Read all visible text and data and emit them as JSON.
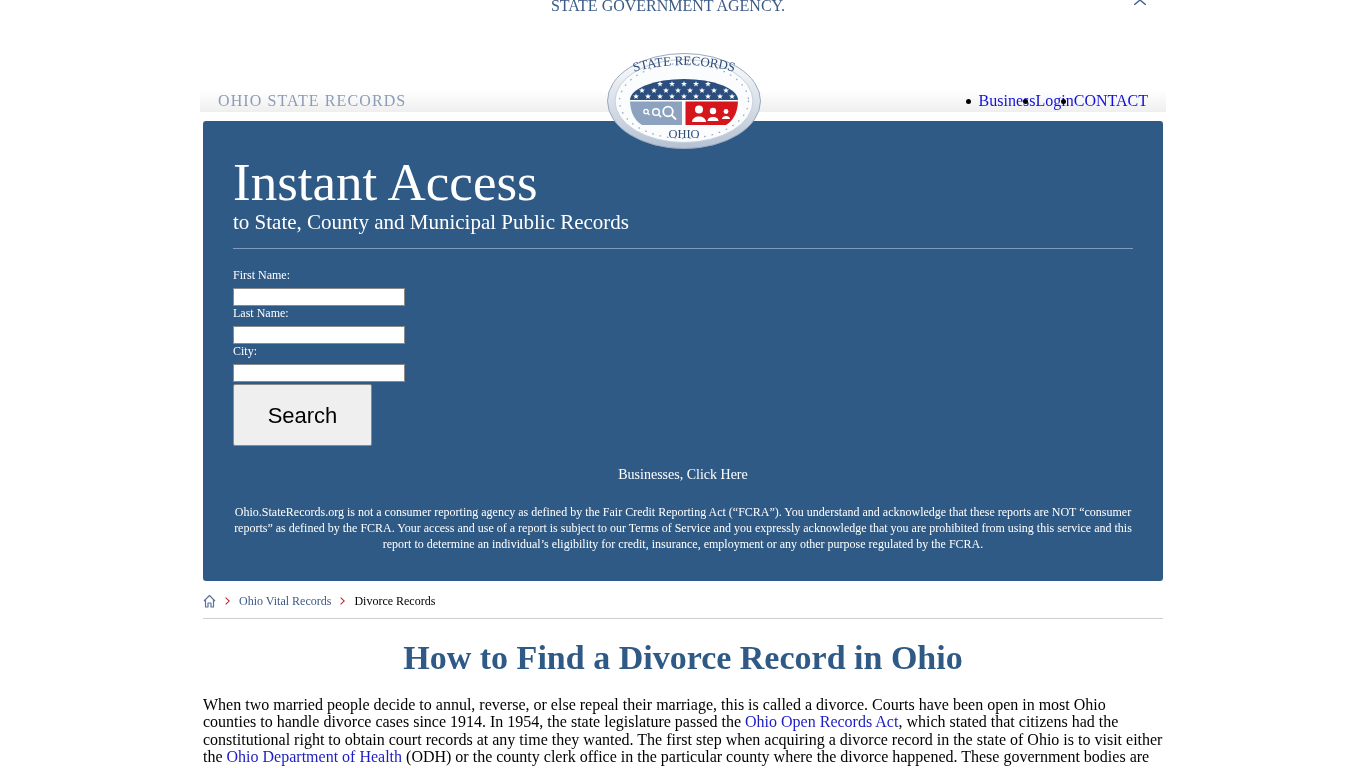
{
  "top_banner": {
    "text": "STATE GOVERNMENT AGENCY."
  },
  "header": {
    "site_name": "OHIO STATE RECORDS",
    "logo": {
      "arc_text": "STATE RECORDS",
      "state_name": "OHIO"
    },
    "nav": [
      {
        "label": "Business"
      },
      {
        "label": "Login"
      },
      {
        "label": "CONTACT"
      }
    ]
  },
  "search_panel": {
    "title": "Instant Access",
    "subtitle": "to State, County and Municipal Public Records",
    "fields": [
      {
        "label": "First Name:"
      },
      {
        "label": "Last Name:"
      },
      {
        "label": "City:"
      }
    ],
    "button": "Search",
    "business_link": "Businesses, Click Here",
    "disclaimer": "Ohio.StateRecords.org is not a consumer reporting agency as defined by the Fair Credit Reporting Act (“FCRA”). You understand and acknowledge that these reports are NOT “consumer reports” as defined by the FCRA. Your access and use of a report is subject to our Terms of Service and you expressly acknowledge that you are prohibited from using this service and this report to determine an individual’s eligibility for credit, insurance, employment or any other purpose regulated by the FCRA."
  },
  "breadcrumb": [
    {
      "label": "Ohio Vital Records",
      "kind": "link"
    },
    {
      "label": "Divorce Records",
      "kind": "current"
    }
  ],
  "article": {
    "heading": "How to Find a Divorce Record in Ohio",
    "paragraph": [
      {
        "kind": "text",
        "text": "When two married people decide to annul, reverse, or else repeal their marriage, this is called a divorce. Courts have been open in most Ohio counties to handle divorce cases since 1914. In 1954, the state legislature passed the "
      },
      {
        "kind": "link",
        "text": "Ohio Open Records Act"
      },
      {
        "kind": "text",
        "text": ", which stated that citizens had the constitutional right to obtain court records at any time they wanted. The first step when acquiring a divorce record in the state of Ohio is to visit either the "
      },
      {
        "kind": "link",
        "text": "Ohio Department of Health"
      },
      {
        "kind": "text",
        "text": " (ODH) or the county clerk office in the particular county where the divorce happened. These government bodies are"
      }
    ]
  }
}
